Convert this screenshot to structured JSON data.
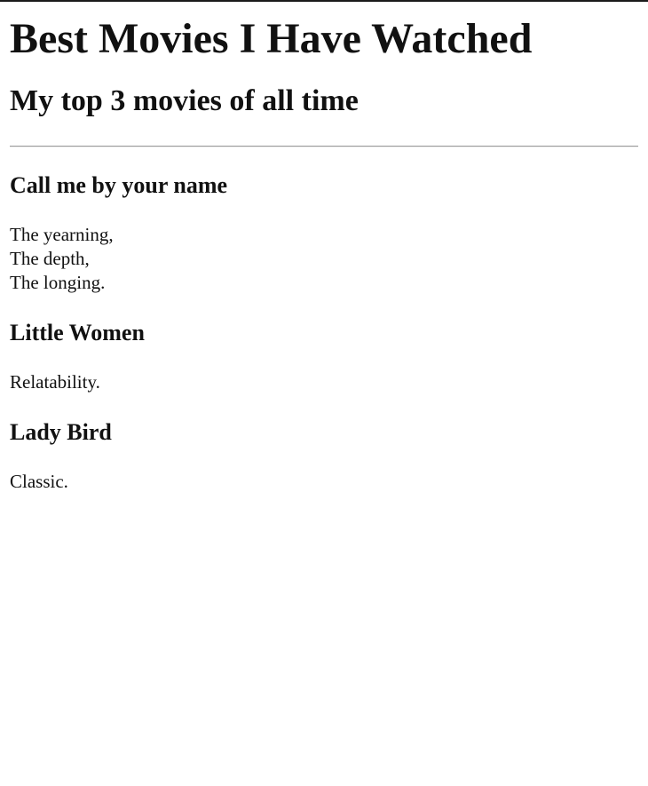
{
  "page": {
    "title": "Best Movies I Have Watched",
    "subtitle": "My top 3 movies of all time"
  },
  "movies": [
    {
      "title": "Call me by your name",
      "lines": [
        "The yearning,",
        "The depth,",
        "The longing."
      ]
    },
    {
      "title": "Little Women",
      "lines": [
        "Relatability."
      ]
    },
    {
      "title": "Lady Bird",
      "lines": [
        "Classic."
      ]
    }
  ]
}
